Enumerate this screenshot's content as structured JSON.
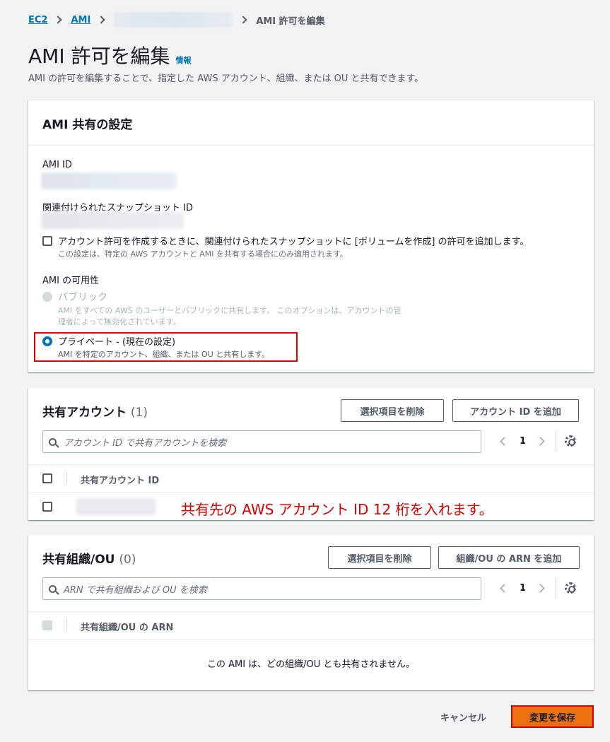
{
  "breadcrumb": {
    "ec2": "EC2",
    "ami": "AMI",
    "current": "AMI 許可を編集"
  },
  "header": {
    "title": "AMI 許可を編集",
    "info": "情報",
    "description": "AMI の許可を編集することで、指定した AWS アカウント、組織、または OU と共有できます。"
  },
  "settings": {
    "heading": "AMI 共有の設定",
    "ami_id_label": "AMI ID",
    "snapshot_label": "関連付けられたスナップショット ID",
    "checkbox_label": "アカウント許可を作成するときに、関連付けられたスナップショットに [ボリュームを作成] の許可を追加します。",
    "checkbox_hint": "この設定は、特定の AWS アカウントと AMI を共有する場合にのみ適用されます。",
    "availability_label": "AMI の可用性",
    "public_label": "パブリック",
    "public_desc_1": "AMI をすべての AWS のユーザーとパブリックに共有します。 このオプションは、アカウントの管",
    "public_desc_2": "理者によって無効化されています。",
    "private_label": "プライベート - (現在の設定)",
    "private_desc": "AMI を特定のアカウント、組織、または OU と共有します。"
  },
  "accounts": {
    "heading": "共有アカウント",
    "count": "(1)",
    "remove_button": "選択項目を削除",
    "add_button": "アカウント ID を追加",
    "search_placeholder": "アカウント ID で共有アカウントを検索",
    "page": "1",
    "column": "共有アカウント ID",
    "annotation": "共有先の AWS アカウント ID 12 桁を入れます。"
  },
  "orgs": {
    "heading": "共有組織/OU",
    "count": "(0)",
    "remove_button": "選択項目を削除",
    "add_button": "組織/OU の ARN を追加",
    "search_placeholder": "ARN で共有組織および OU を検索",
    "page": "1",
    "column": "共有組織/OU の ARN",
    "empty": "この AMI は、どの組織/OU とも共有されません。"
  },
  "footer": {
    "cancel": "キャンセル",
    "save": "変更を保存"
  },
  "colors": {
    "link": "#0073bb",
    "primary": "#ec7211",
    "highlight": "#d80000"
  }
}
